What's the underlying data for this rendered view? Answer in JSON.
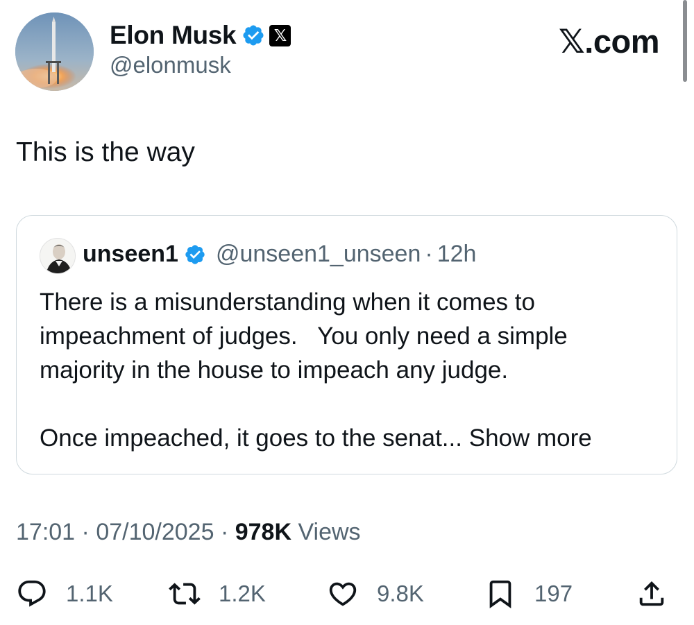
{
  "author": {
    "display_name": "Elon Musk",
    "handle": "@elonmusk",
    "verified_icon": "verified-badge-icon",
    "affiliate_badge": "𝕏"
  },
  "brand": "𝕏.com",
  "tweet": {
    "text": "This is the way"
  },
  "quoted": {
    "display_name": "unseen1",
    "handle": "@unseen1_unseen",
    "separator": "·",
    "time": "12h",
    "lines": [
      "There is a misunderstanding when it comes to",
      "impeachment of judges.   You only need a simple",
      "majority in the house to impeach any judge."
    ],
    "last_line": "Once impeached, it goes to the senat...",
    "show_more": "Show more"
  },
  "meta": {
    "time": "17:01",
    "date": "07/10/2025",
    "views_count": "978K",
    "views_label": "Views",
    "separator": "·"
  },
  "actions": {
    "replies": "1.1K",
    "reposts": "1.2K",
    "likes": "9.8K",
    "bookmarks": "197"
  },
  "colors": {
    "text": "#0f1419",
    "secondary": "#536471",
    "verified": "#1d9bf0",
    "border": "#cfd9de"
  }
}
